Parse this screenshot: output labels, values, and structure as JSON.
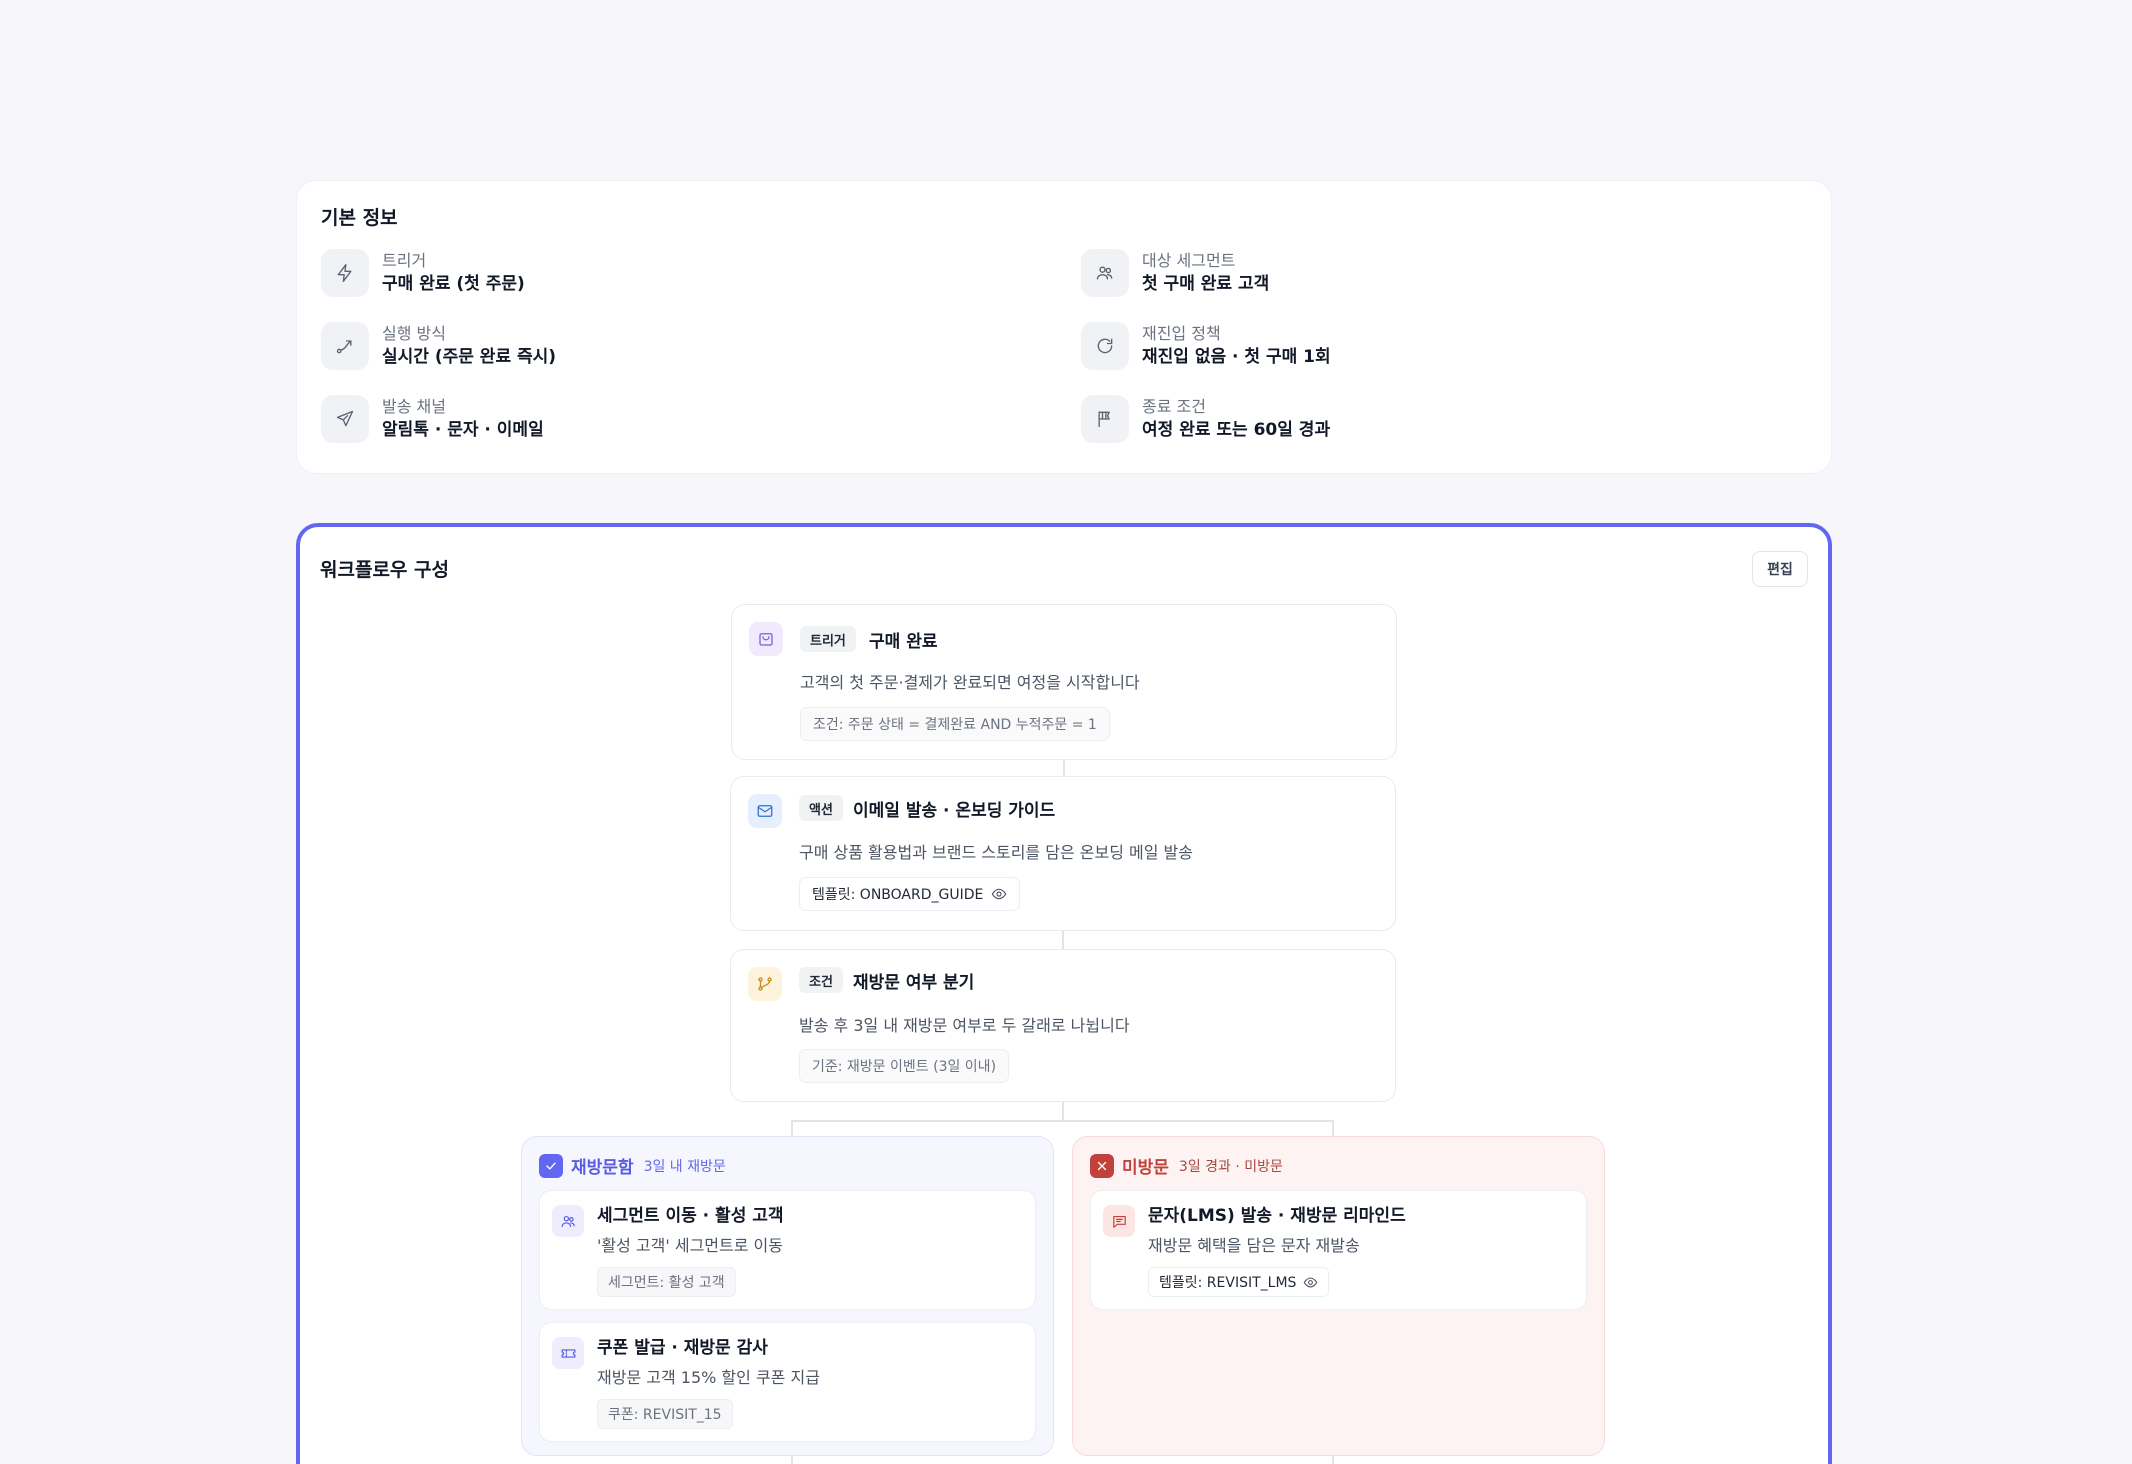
{
  "basic_info": {
    "title": "기본 정보",
    "items": [
      {
        "label": "트리거",
        "value": "구매 완료 (첫 주문)",
        "icon": "bolt-icon"
      },
      {
        "label": "대상 세그먼트",
        "value": "첫 구매 완료 고객",
        "icon": "users-icon"
      },
      {
        "label": "실행 방식",
        "value": "실시간 (주문 완료 즉시)",
        "icon": "route-icon"
      },
      {
        "label": "재진입 정책",
        "value": "재진입 없음 · 첫 구매 1회",
        "icon": "refresh-icon"
      },
      {
        "label": "발송 채널",
        "value": "알림톡 · 문자 · 이메일",
        "icon": "send-icon"
      },
      {
        "label": "종료 조건",
        "value": "여정 완료 또는 60일 경과",
        "icon": "flag-icon"
      }
    ]
  },
  "workflow": {
    "title": "워크플로우 구성",
    "edit_label": "편집",
    "nodes": [
      {
        "tag": "트리거",
        "title": "구매 완료",
        "desc": "고객의 첫 주문·결제가 완료되면 여정을 시작합니다",
        "pill": "조건: 주문 상태 = 결제완료 AND 누적주문 = 1",
        "icon": "shopping-bag-icon"
      },
      {
        "tag": "액션",
        "title": "이메일 발송 · 온보딩 가이드",
        "desc": "구매 상품 활용법과 브랜드 스토리를 담은 온보딩 메일 발송",
        "pill": "템플릿: ONBOARD_GUIDE",
        "icon": "mail-icon"
      },
      {
        "tag": "조건",
        "title": "재방문 여부 분기",
        "desc": "발송 후 3일 내 재방문 여부로 두 갈래로 나뉩니다",
        "pill": "기준: 재방문 이벤트 (3일 이내)",
        "icon": "branch-icon"
      }
    ],
    "branches": {
      "yes": {
        "name": "재방문함",
        "sub": "3일 내 재방문",
        "color": "#6366f1",
        "items": [
          {
            "title": "세그먼트 이동 · 활성 고객",
            "desc": "'활성 고객' 세그먼트로 이동",
            "pill": "세그먼트: 활성 고객"
          },
          {
            "title": "쿠폰 발급 · 재방문 감사",
            "desc": "재방문 고객 15% 할인 쿠폰 지급",
            "pill": "쿠폰: REVISIT_15"
          }
        ]
      },
      "no": {
        "name": "미방문",
        "sub": "3일 경과 · 미방문",
        "color": "#c2413a",
        "items": [
          {
            "title": "문자(LMS) 발송 · 재방문 리마인드",
            "desc": "재방문 혜택을 담은 문자 재발송",
            "pill": "템플릿: REVISIT_LMS"
          }
        ]
      }
    }
  }
}
